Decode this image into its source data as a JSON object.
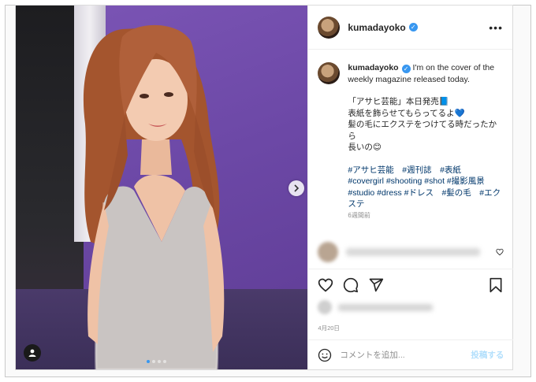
{
  "post": {
    "username": "kumadayoko",
    "caption": {
      "intro": "I'm on the cover of the weekly magazine released today.",
      "lines": [
        "「アサヒ芸能」本日発売📘",
        "表紙を飾らせてもらってるよ💙",
        "髪の毛にエクステをつけてる時だったから",
        "長いの😊"
      ],
      "hashtags": "#アサヒ芸能　#週刊誌　#表紙　#covergirl #shooting #shot #撮影風景　#studio #dress #ドレス　#髪の毛　#エクステ",
      "time": "6週間前"
    },
    "date": "4月20日",
    "add_comment_placeholder": "コメントを追加...",
    "post_button": "投稿する"
  },
  "icons": {
    "more": "more-icon",
    "verified": "verified-badge-icon",
    "next": "chevron-right-icon",
    "user_tag": "user-tag-icon",
    "like": "heart-icon",
    "comment": "comment-icon",
    "share": "share-icon",
    "save": "bookmark-icon",
    "emoji": "emoji-icon"
  },
  "colors": {
    "accent": "#3897f0",
    "hashtag": "#00376b",
    "muted": "#8e8e8e",
    "post_button": "#b2dffc"
  }
}
